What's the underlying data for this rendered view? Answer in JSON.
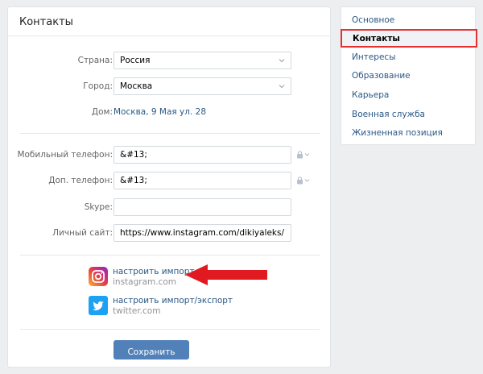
{
  "panel": {
    "title": "Контакты"
  },
  "form": {
    "country": {
      "label": "Страна:",
      "value": "Россия"
    },
    "city": {
      "label": "Город:",
      "value": "Москва"
    },
    "home": {
      "label": "Дом:",
      "value": "Москва, 9 Мая ул. 28"
    },
    "mobile": {
      "label": "Мобильный телефон:",
      "value": "&#13;"
    },
    "extra_phone": {
      "label": "Доп. телефон:",
      "value": "&#13;"
    },
    "skype": {
      "label": "Skype:",
      "value": ""
    },
    "website": {
      "label": "Личный сайт:",
      "value": "https://www.instagram.com/dikiyaleks/"
    }
  },
  "social": {
    "instagram": {
      "link": "настроить импорт",
      "domain": "instagram.com"
    },
    "twitter": {
      "link": "настроить импорт/экспорт",
      "domain": "twitter.com"
    }
  },
  "save_label": "Сохранить",
  "menu": {
    "items": [
      {
        "label": "Основное"
      },
      {
        "label": "Контакты",
        "active": true
      },
      {
        "label": "Интересы"
      },
      {
        "label": "Образование"
      },
      {
        "label": "Карьера"
      },
      {
        "label": "Военная служба"
      },
      {
        "label": "Жизненная позиция"
      }
    ]
  },
  "colors": {
    "link": "#2a5885",
    "accent": "#5181b8",
    "highlight": "#e63030"
  }
}
